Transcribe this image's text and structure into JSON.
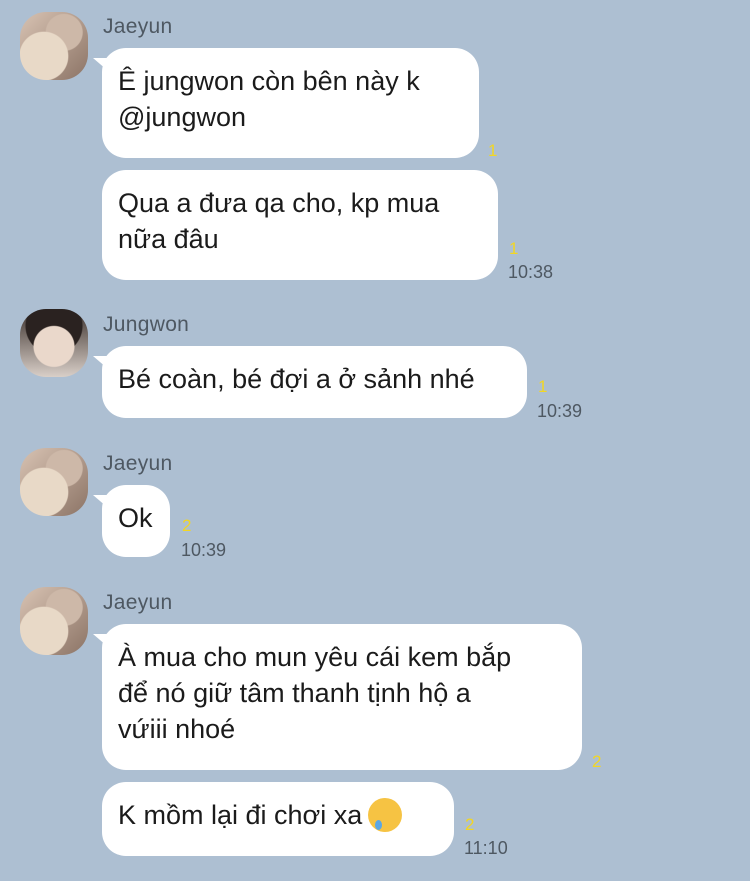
{
  "messages": [
    {
      "sender": "Jaeyun",
      "bubbles": [
        {
          "text_lines": [
            "Ê jungwon còn bên này k",
            "@jungwon"
          ],
          "read": "1",
          "time": ""
        },
        {
          "text_lines": [
            "Qua a đưa qa cho, kp mua",
            "nữa đâu"
          ],
          "read": "1",
          "time": "10:38"
        }
      ]
    },
    {
      "sender": "Jungwon",
      "bubbles": [
        {
          "text_lines": [
            "Bé coàn, bé đợi a ở sảnh nhé"
          ],
          "read": "1",
          "time": "10:39"
        }
      ]
    },
    {
      "sender": "Jaeyun",
      "bubbles": [
        {
          "text_lines": [
            "Ok"
          ],
          "read": "2",
          "time": "10:39"
        }
      ]
    },
    {
      "sender": "Jaeyun",
      "bubbles": [
        {
          "text_lines": [
            "À mua cho mun yêu cái kem bắp",
            "để nó giữ tâm thanh tịnh hộ a",
            "vứiii nhoé"
          ],
          "read": "2",
          "time": ""
        },
        {
          "text_lines": [
            "K mồm lại đi chơi xa"
          ],
          "emoji": "crying-face-emoji",
          "read": "2",
          "time": "11:10"
        }
      ]
    }
  ],
  "colors": {
    "background": "#adbfd2",
    "bubble": "#ffffff",
    "read_count": "#f2d624",
    "meta_text": "#4e5862"
  }
}
